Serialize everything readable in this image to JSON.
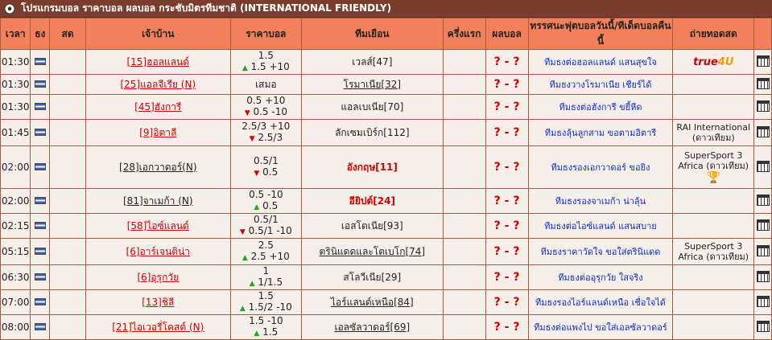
{
  "title": "โปรแกรมบอล ราคาบอล ผลบอล กระชับมิตรทีมชาติ (INTERNATIONAL FRIENDLY)",
  "headers": [
    "เวลา",
    "ธง",
    "สด",
    "เจ้าบ้าน",
    "ราคาบอล",
    "ทีมเยือน",
    "ครึ่งแรก",
    "ผลบอล",
    "ทรรศนะฟุตบอลวันนี้/ทีเด็ดบอลคืนนี้",
    "ถ่ายทอดสด",
    ""
  ],
  "rows": [
    {
      "time": "01:30",
      "home": "[15]ฮอลแลนด์",
      "home_red": true,
      "odds1": "1.5",
      "odds2": "1.5 +10",
      "dir": "up",
      "away": "เวลส์[47]",
      "away_style": "",
      "score": "? - ?",
      "tip": "ทีมธงต่อฮอลแลนด์ แสนสุขใจ",
      "tv": "true4U"
    },
    {
      "time": "01:30",
      "home": "[25]แอลจีเรีย (N)",
      "home_red": true,
      "home_plain_u": false,
      "odds1": "เสมอ",
      "odds2": "",
      "dir": "",
      "away": "โรมาเนีย[32]",
      "away_style": "u",
      "score": "? - ?",
      "tip": "ทีมธงวางโรมาเนีย เชียร์ได้",
      "tv": ""
    },
    {
      "time": "01:30",
      "home": "[45]ฮังการี",
      "home_red": true,
      "odds1": "0.5 +10",
      "odds2": "0.5 -10",
      "dir": "down",
      "away": "แอลเบเนีย[70]",
      "away_style": "",
      "score": "? - ?",
      "tip": "ทีมธงต่อฮังการี ขยี้หีด",
      "tv": ""
    },
    {
      "time": "01:45",
      "home": "[9]อิตาลี",
      "home_red": true,
      "odds1": "2.5/3 +10",
      "odds2": "2.5/3",
      "dir": "down",
      "away": "ลักเซมเบิร์ก[112]",
      "away_style": "",
      "score": "? - ?",
      "tip": "ทีมธงลุ้นลูกสาม ขอตามอิตารี",
      "tv": "RAI International (ดาวเทียม)"
    },
    {
      "time": "02:00",
      "home": "[28]เอกวาดอร์(N)",
      "home_red": false,
      "odds1": "0.5/1",
      "odds2": "0.5",
      "dir": "down",
      "away": "อังกฤษ[11]",
      "away_style": "red",
      "score": "? - ?",
      "tip": "ทีมธงรองเอกวาดอร์ ขอยิง",
      "tv": "SuperSport 3 Africa (ดาวเทียม)",
      "trophy": true
    },
    {
      "time": "02:00",
      "home": "[81]จาเมก้า (N)",
      "home_red": false,
      "odds1": "0.5 -10",
      "odds2": "0.5",
      "dir": "up",
      "away": "อียิปต์[24]",
      "away_style": "red",
      "score": "? - ?",
      "tip": "ทีมธงรองจาเมก้า น่าลุ้น",
      "tv": ""
    },
    {
      "time": "02:15",
      "home": "[58]ไอซ์แลนด์",
      "home_red": true,
      "odds1": "0.5/1",
      "odds2": "0.5/1 -10",
      "dir": "down",
      "away": "เอสโตเนีย[93]",
      "away_style": "",
      "score": "? - ?",
      "tip": "ทีมธงต่อไอซ์แลนด์ แสนสบาย",
      "tv": ""
    },
    {
      "time": "05:15",
      "home": "[6]อาร์เจนติน่า",
      "home_red": true,
      "odds1": "2.5",
      "odds2": "2.5 +10",
      "dir": "up",
      "away": "ตรินิแดดและโตเบโก[74]",
      "away_style": "u",
      "score": "? - ?",
      "tip": "ทีมธงราคาวัดใจ ขอใส่ตรินิแดด",
      "tv": "SuperSport 3 Africa (ดาวเทียม)"
    },
    {
      "time": "06:30",
      "home": "[6]อุรุกวัย",
      "home_red": true,
      "odds1": "1",
      "odds2": "1/1.5",
      "dir": "up",
      "away": "สโลวีเนีย[29]",
      "away_style": "",
      "score": "? - ?",
      "tip": "ทีมธงต่ออุรุกวัย ใสจริง",
      "tv": ""
    },
    {
      "time": "07:00",
      "home": "[13]ชิลี",
      "home_red": true,
      "odds1": "1.5",
      "odds2": "1.5/2 -10",
      "dir": "up",
      "away": "ไอร์แลนด์เหนือ[84]",
      "away_style": "u",
      "score": "? - ?",
      "tip": "ทีมธงรองไอร์แลนด์เหนือ เชื่อใจได้",
      "tv": ""
    },
    {
      "time": "08:00",
      "home": "[21]ไอเวอรี่โคสต์ (N)",
      "home_red": true,
      "odds1": "1.5 -10",
      "odds2": "1.5",
      "dir": "up",
      "away": "เอลซัลวาดอร์[69]",
      "away_style": "u",
      "score": "? - ?",
      "tip": "ทีมธงต่อแพงไป ขอใส่เอลซัลวาดอร์",
      "tv": ""
    }
  ]
}
